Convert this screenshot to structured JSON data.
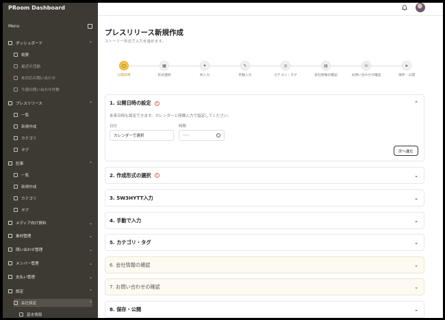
{
  "app": {
    "title": "PRoom Dashboard"
  },
  "sidebar": {
    "menu_label": "Menu",
    "items": [
      {
        "label": "ダッシュボード",
        "level": 0,
        "chevron": "⌃",
        "icon": "grid-icon"
      },
      {
        "label": "概要",
        "level": 1,
        "icon": "chart-icon"
      },
      {
        "label": "最近の活動",
        "level": 1,
        "icon": "activity-icon",
        "muted": true
      },
      {
        "label": "未対応の問い合わせ",
        "level": 1,
        "icon": "mail-icon",
        "muted": true
      },
      {
        "label": "今週の問い合わせ件数",
        "level": 1,
        "icon": "trend-icon",
        "muted": true
      },
      {
        "label": "プレスリリース",
        "level": 0,
        "chevron": "⌃",
        "icon": "megaphone-icon"
      },
      {
        "label": "一覧",
        "level": 1,
        "icon": "list-icon"
      },
      {
        "label": "新規作成",
        "level": 1,
        "icon": "plus-square-icon"
      },
      {
        "label": "カテゴリ",
        "level": 1,
        "icon": "folder-icon"
      },
      {
        "label": "タグ",
        "level": 1,
        "icon": "tag-icon"
      },
      {
        "label": "記事",
        "level": 0,
        "chevron": "⌃",
        "icon": "document-icon"
      },
      {
        "label": "一覧",
        "level": 1,
        "icon": "list-icon"
      },
      {
        "label": "新規作成",
        "level": 1,
        "icon": "plus-square-icon"
      },
      {
        "label": "カテゴリ",
        "level": 1,
        "icon": "folder-icon"
      },
      {
        "label": "タグ",
        "level": 1,
        "icon": "tag-icon"
      },
      {
        "label": "メディア向け資料",
        "level": 0,
        "chevron": "⌄",
        "icon": "media-icon"
      },
      {
        "label": "素材管理",
        "level": 0,
        "chevron": "⌄",
        "icon": "image-icon"
      },
      {
        "label": "問い合わせ管理",
        "level": 0,
        "chevron": "⌄",
        "icon": "inbox-icon"
      },
      {
        "label": "メンバー管理",
        "level": 0,
        "chevron": "⌄",
        "icon": "users-icon"
      },
      {
        "label": "支払い管理",
        "level": 0,
        "chevron": "⌄",
        "icon": "wallet-icon"
      },
      {
        "label": "設定",
        "level": 0,
        "chevron": "⌃",
        "icon": "gear-icon"
      },
      {
        "label": "会社設定",
        "level": 1,
        "chevron": "⌃",
        "icon": "building-icon",
        "active": true
      },
      {
        "label": "基本情報",
        "level": 2,
        "icon": "info-icon"
      }
    ]
  },
  "page": {
    "title": "プレスリリース新規作成",
    "subtitle": "ストーリー形式で入力を進めます。"
  },
  "stepper": {
    "steps": [
      {
        "label": "公開日時",
        "icon": "▢",
        "active": true
      },
      {
        "label": "形式選択",
        "icon": "▦"
      },
      {
        "label": "AI入力",
        "icon": "✦"
      },
      {
        "label": "手動入力",
        "icon": "✎"
      },
      {
        "label": "カテゴリ・タグ",
        "icon": "◎"
      },
      {
        "label": "会社情報の確認",
        "icon": "▤"
      },
      {
        "label": "お問い合わせの確認",
        "icon": "☏"
      },
      {
        "label": "保存・公開",
        "icon": "➤"
      }
    ]
  },
  "sections": [
    {
      "title": "1. 公開日時の設定",
      "warn": true,
      "expanded": true
    },
    {
      "title": "2. 作成形式の選択",
      "warn": true
    },
    {
      "title": "3. 5W3HYTT入力"
    },
    {
      "title": "4. 手動で入力"
    },
    {
      "title": "5. カテゴリ・タグ"
    },
    {
      "title": "6. 会社情報の確認",
      "warm": true
    },
    {
      "title": "7. お問い合わせの確認",
      "warm": true
    },
    {
      "title": "8. 保存・公開"
    }
  ],
  "schedule": {
    "description": "未来日時も設定できます。カレンダーと時間入力で指定してください。",
    "date_label": "日付",
    "date_placeholder": "カレンダーで選択",
    "time_label": "時間",
    "time_placeholder": "--:--",
    "next_label": "次へ進む"
  },
  "colors": {
    "sidebar_bg": "#3d3a33",
    "accent": "#f4c247",
    "warning": "#e26a6a"
  }
}
